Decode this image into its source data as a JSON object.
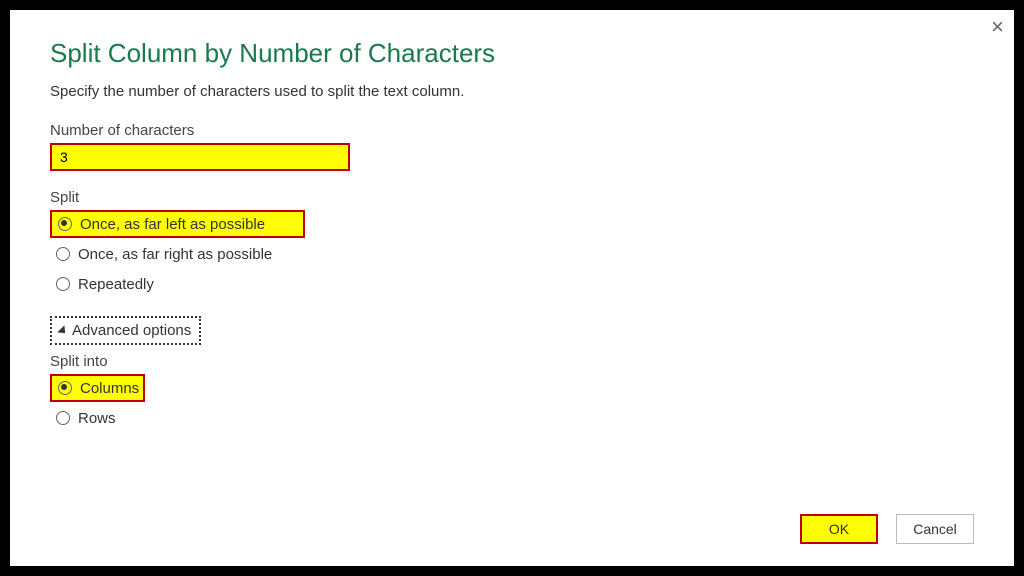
{
  "title": "Split Column by Number of Characters",
  "subtitle": "Specify the number of characters used to split the text column.",
  "num_label": "Number of characters",
  "num_value": "3",
  "split_label": "Split",
  "split_options": {
    "left": "Once, as far left as possible",
    "right": "Once, as far right as possible",
    "repeat": "Repeatedly"
  },
  "adv_label": "Advanced options",
  "into_label": "Split into",
  "into_options": {
    "cols": "Columns",
    "rows": "Rows"
  },
  "buttons": {
    "ok": "OK",
    "cancel": "Cancel"
  }
}
